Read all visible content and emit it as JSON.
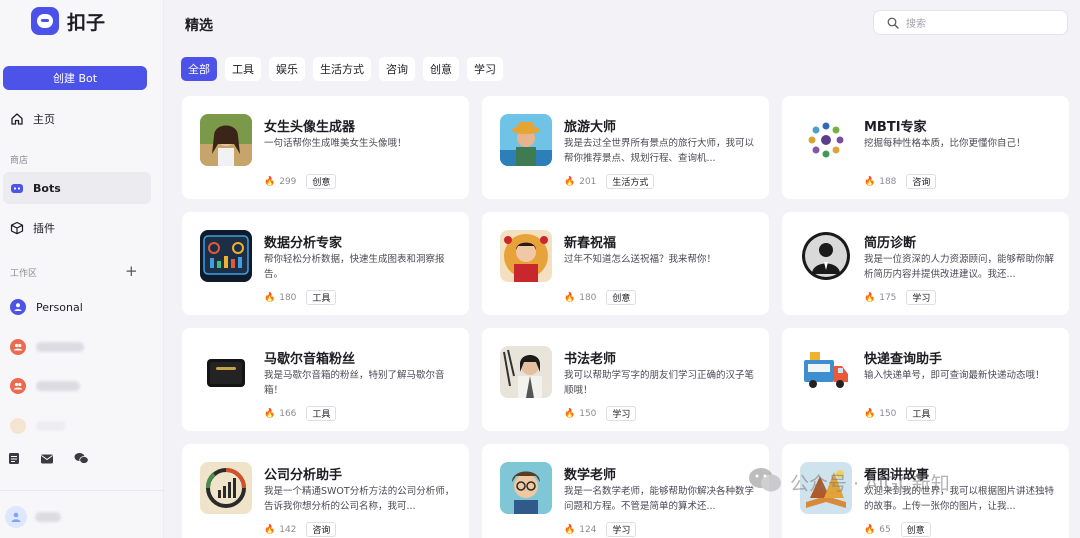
{
  "brand": {
    "name": "扣子",
    "color": "#4d53e8"
  },
  "sidebar": {
    "create_label": "创建 Bot",
    "home_label": "主页",
    "store_section": "商店",
    "bots_label": "Bots",
    "plugins_label": "插件",
    "workspace_section": "工作区",
    "workspace_items": [
      "Personal"
    ]
  },
  "main": {
    "title": "精选",
    "search_placeholder": "搜索",
    "tabs": [
      "全部",
      "工具",
      "娱乐",
      "生活方式",
      "咨询",
      "创意",
      "学习"
    ]
  },
  "cards": [
    {
      "title": "女生头像生成器",
      "desc": "一句话帮你生成唯美女生头像哦！",
      "count": "299",
      "tag": "创意"
    },
    {
      "title": "旅游大师",
      "desc": "我是去过全世界所有景点的旅行大师，我可以帮你推荐景点、规划行程、查询机...",
      "count": "201",
      "tag": "生活方式"
    },
    {
      "title": "MBTI专家",
      "desc": "挖掘每种性格本质，比你更懂你自己！",
      "count": "188",
      "tag": "咨询"
    },
    {
      "title": "数据分析专家",
      "desc": "帮你轻松分析数据，快速生成图表和洞察报告。",
      "count": "180",
      "tag": "工具"
    },
    {
      "title": "新春祝福",
      "desc": "过年不知道怎么送祝福？我来帮你！",
      "count": "180",
      "tag": "创意"
    },
    {
      "title": "简历诊断",
      "desc": "我是一位资深的人力资源顾问，能够帮助你解析简历内容并提供改进建议。我还...",
      "count": "175",
      "tag": "学习"
    },
    {
      "title": "马歇尔音箱粉丝",
      "desc": "我是马歇尔音箱的粉丝，特别了解马歇尔音箱！",
      "count": "166",
      "tag": "工具"
    },
    {
      "title": "书法老师",
      "desc": "我可以帮助学写字的朋友们学习正确的汉子笔顺哦！",
      "count": "150",
      "tag": "学习"
    },
    {
      "title": "快递查询助手",
      "desc": "输入快递单号，即可查询最新快递动态哦！",
      "count": "150",
      "tag": "工具"
    },
    {
      "title": "公司分析助手",
      "desc": "我是一个精通SWOT分析方法的公司分析师，告诉我你想分析的公司名称，我可...",
      "count": "142",
      "tag": "咨询"
    },
    {
      "title": "数学老师",
      "desc": "我是一名数学老师，能够帮助你解决各种数学问题和方程。不管是简单的算术还...",
      "count": "124",
      "tag": "学习"
    },
    {
      "title": "看图讲故事",
      "desc": "欢迎来到我的世界，我可以根据图片讲述独特的故事。上传一张你的图片，让我...",
      "count": "65",
      "tag": "创意"
    }
  ],
  "watermark": "公众号 · AIGC新知"
}
